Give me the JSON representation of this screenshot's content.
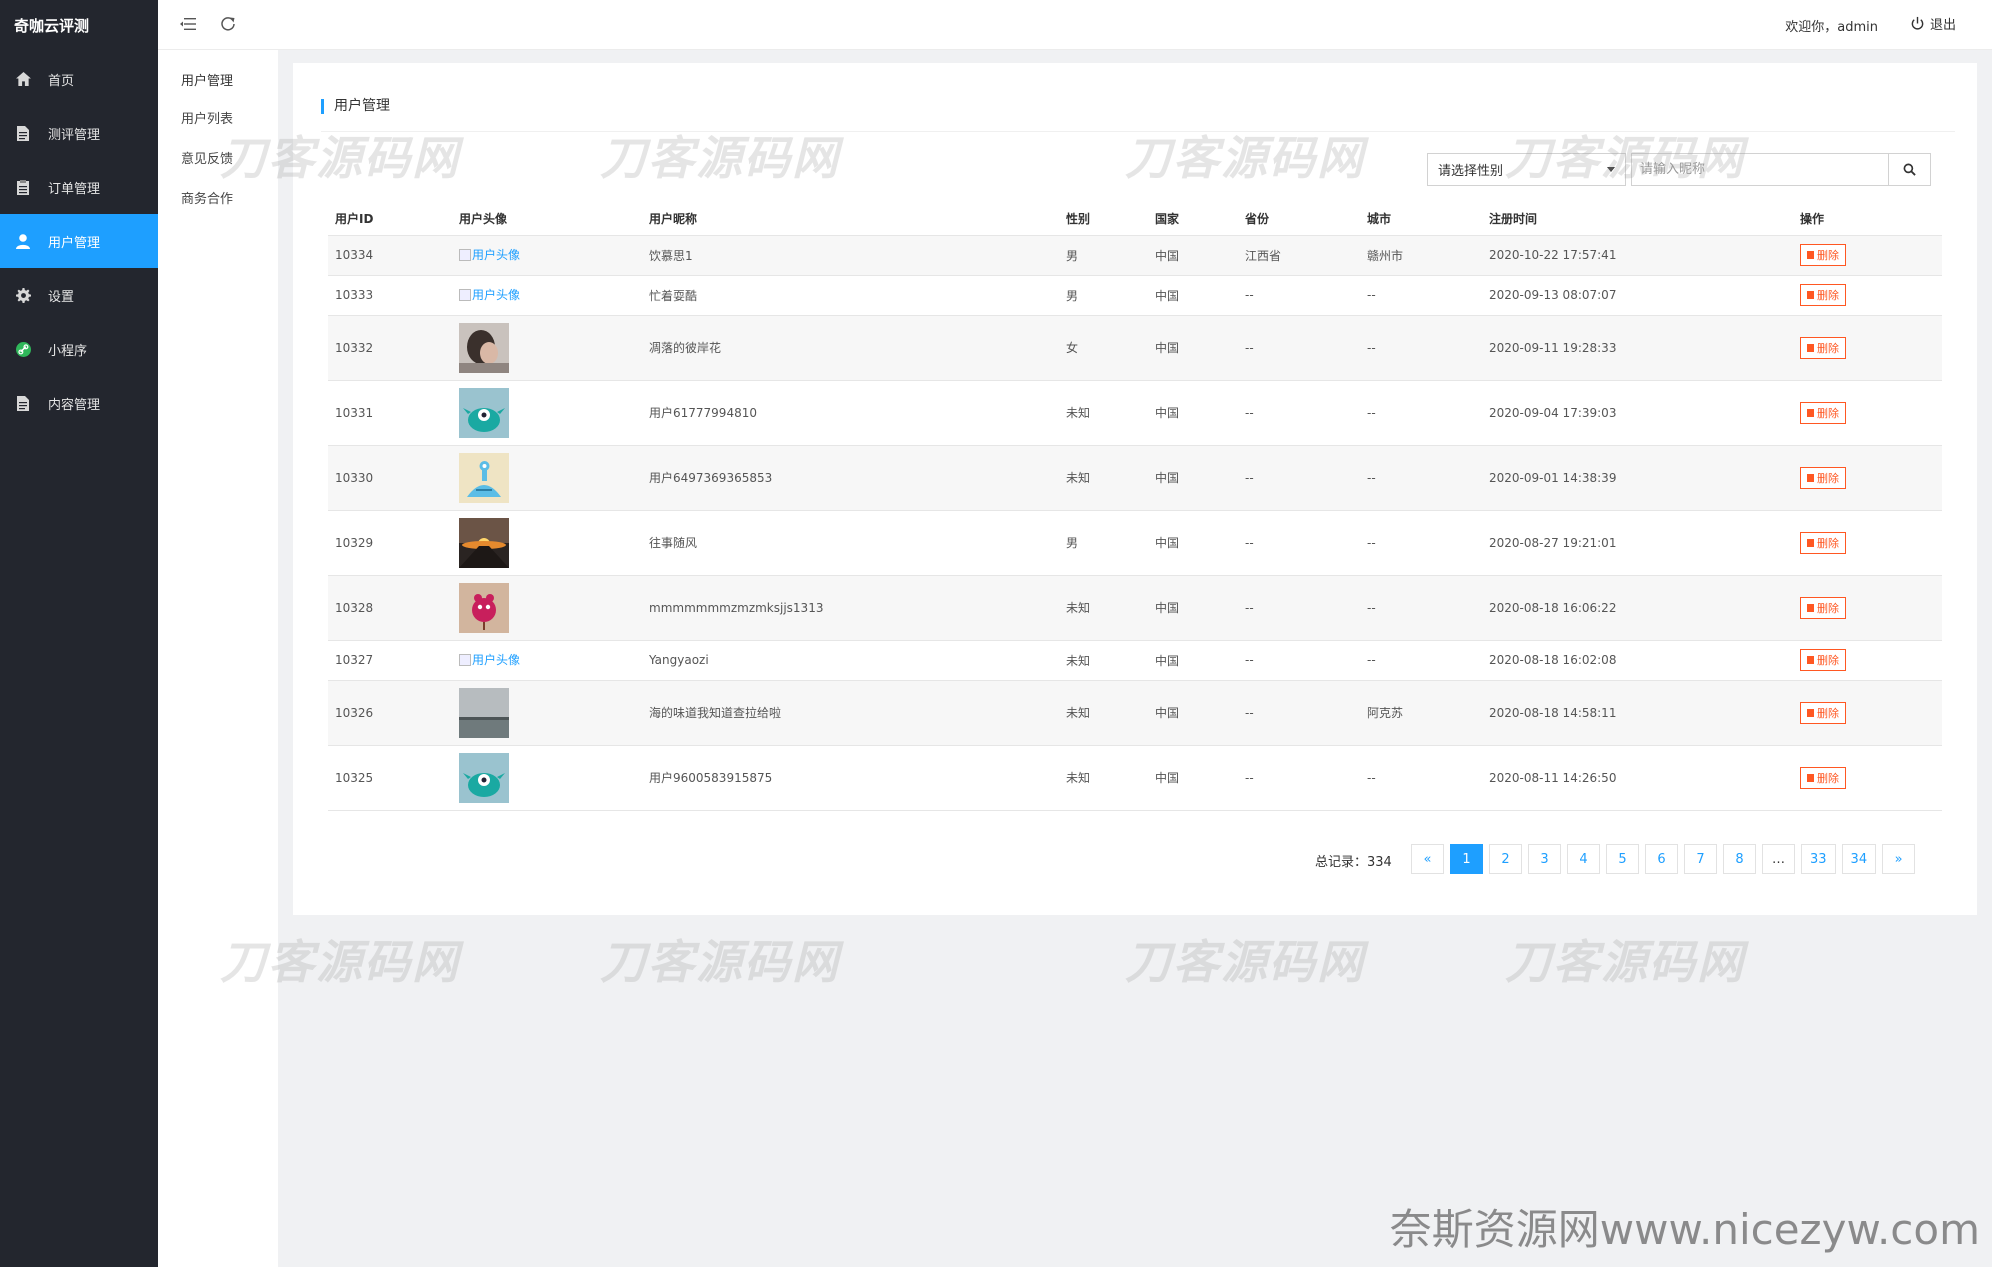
{
  "brand": "奇咖云评测",
  "sidebar": {
    "items": [
      {
        "label": "首页",
        "icon": "home-icon"
      },
      {
        "label": "测评管理",
        "icon": "document-icon"
      },
      {
        "label": "订单管理",
        "icon": "clipboard-icon"
      },
      {
        "label": "用户管理",
        "icon": "user-icon",
        "active": true
      },
      {
        "label": "设置",
        "icon": "gear-icon"
      },
      {
        "label": "小程序",
        "icon": "link-icon"
      },
      {
        "label": "内容管理",
        "icon": "document-icon"
      }
    ]
  },
  "submenu": {
    "title": "用户管理",
    "items": [
      "用户列表",
      "意见反馈",
      "商务合作"
    ]
  },
  "header": {
    "welcome": "欢迎你，admin",
    "logout": "退出"
  },
  "card": {
    "title": "用户管理",
    "gender_select": "请选择性别",
    "search_placeholder": "请输入昵称"
  },
  "table": {
    "columns": [
      "用户ID",
      "用户头像",
      "用户昵称",
      "性别",
      "国家",
      "省份",
      "城市",
      "注册时间",
      "操作"
    ],
    "broken_avatar_alt": "用户头像",
    "delete_label": "删除",
    "rows": [
      {
        "id": "10334",
        "avatar": "broken",
        "nickname": "饮慕思1",
        "gender": "男",
        "country": "中国",
        "province": "江西省",
        "city": "赣州市",
        "time": "2020-10-22 17:57:41"
      },
      {
        "id": "10333",
        "avatar": "broken",
        "nickname": "忙着耍酷",
        "gender": "男",
        "country": "中国",
        "province": "--",
        "city": "--",
        "time": "2020-09-13 08:07:07"
      },
      {
        "id": "10332",
        "avatar": "photo-person",
        "nickname": "凋落的彼岸花",
        "gender": "女",
        "country": "中国",
        "province": "--",
        "city": "--",
        "time": "2020-09-11 19:28:33"
      },
      {
        "id": "10331",
        "avatar": "cartoon-teal",
        "nickname": "用户61777994810",
        "gender": "未知",
        "country": "中国",
        "province": "--",
        "city": "--",
        "time": "2020-09-04 17:39:03"
      },
      {
        "id": "10330",
        "avatar": "cartoon-blue",
        "nickname": "用户6497369365853",
        "gender": "未知",
        "country": "中国",
        "province": "--",
        "city": "--",
        "time": "2020-09-01 14:38:39"
      },
      {
        "id": "10329",
        "avatar": "photo-sunset",
        "nickname": "往事随风",
        "gender": "男",
        "country": "中国",
        "province": "--",
        "city": "--",
        "time": "2020-08-27 19:21:01"
      },
      {
        "id": "10328",
        "avatar": "cartoon-pink",
        "nickname": "mmmmmmmzmzmksjjs1313",
        "gender": "未知",
        "country": "中国",
        "province": "--",
        "city": "--",
        "time": "2020-08-18 16:06:22"
      },
      {
        "id": "10327",
        "avatar": "broken",
        "nickname": "Yangyaozi",
        "gender": "未知",
        "country": "中国",
        "province": "--",
        "city": "--",
        "time": "2020-08-18 16:02:08"
      },
      {
        "id": "10326",
        "avatar": "photo-sea",
        "nickname": "海的味道我知道查拉给啦",
        "gender": "未知",
        "country": "中国",
        "province": "--",
        "city": "阿克苏",
        "time": "2020-08-18 14:58:11"
      },
      {
        "id": "10325",
        "avatar": "cartoon-teal",
        "nickname": "用户9600583915875",
        "gender": "未知",
        "country": "中国",
        "province": "--",
        "city": "--",
        "time": "2020-08-11 14:26:50"
      }
    ]
  },
  "pagination": {
    "total_label": "总记录：334",
    "prev": "«",
    "next": "»",
    "pages": [
      "1",
      "2",
      "3",
      "4",
      "5",
      "6",
      "7",
      "8",
      "…",
      "33",
      "34"
    ],
    "current": "1"
  },
  "watermark": "刀客源码网",
  "site_watermark": "奈斯资源网www.nicezyw.com"
}
